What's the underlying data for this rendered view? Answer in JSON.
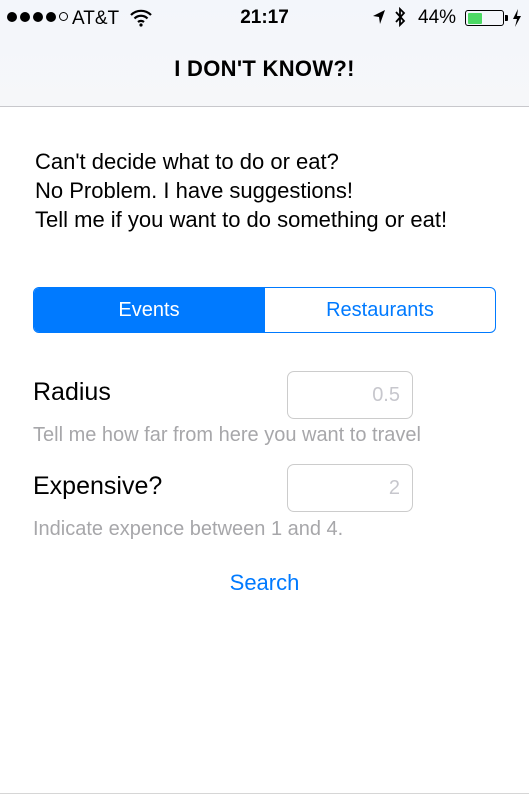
{
  "status_bar": {
    "carrier": "AT&T",
    "time": "21:17",
    "battery_percent": "44%",
    "battery_level": 0.44,
    "battery_color": "#4cd964",
    "icons": [
      "signal-dots-icon",
      "wifi-icon",
      "location-arrow-icon",
      "bluetooth-icon",
      "battery-icon",
      "charging-bolt-icon"
    ]
  },
  "nav": {
    "title": "I DON'T KNOW?!"
  },
  "intro": {
    "line1": "Can't decide what to do or eat?",
    "line2": "No Problem.  I have suggestions!",
    "line3": "Tell me if you want to do something or eat!"
  },
  "segmented": {
    "options": [
      {
        "label": "Events",
        "selected": true
      },
      {
        "label": "Restaurants",
        "selected": false
      }
    ],
    "accent": "#007aff"
  },
  "radius": {
    "label": "Radius",
    "placeholder": "0.5",
    "hint": "Tell me how far from here you want to travel"
  },
  "expensive": {
    "label": "Expensive?",
    "placeholder": "2",
    "hint": "Indicate expence between 1 and 4."
  },
  "search": {
    "label": "Search"
  }
}
